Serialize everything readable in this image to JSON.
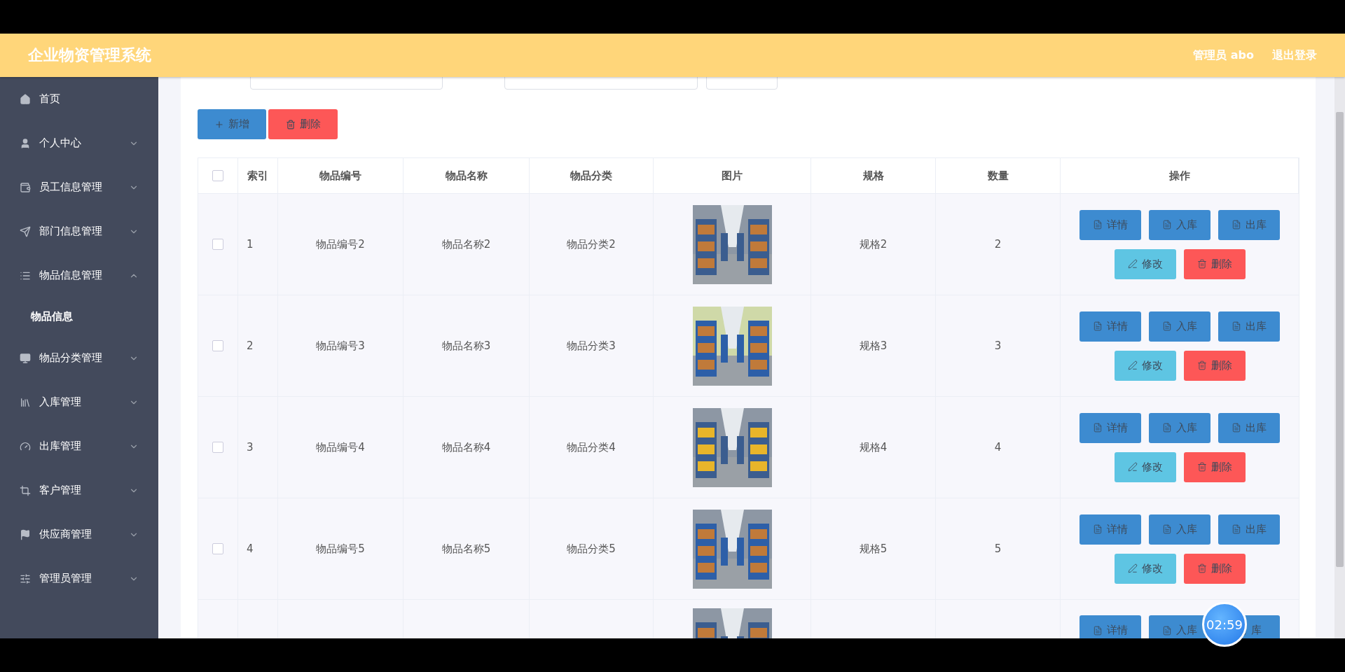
{
  "header": {
    "title": "企业物资管理系统",
    "user": "管理员 abo",
    "logout": "退出登录"
  },
  "sidebar": {
    "items": [
      {
        "label": "首页",
        "kind": "link"
      },
      {
        "label": "个人中心",
        "kind": "menu",
        "expanded": false
      },
      {
        "label": "员工信息管理",
        "kind": "menu",
        "expanded": false
      },
      {
        "label": "部门信息管理",
        "kind": "menu",
        "expanded": false
      },
      {
        "label": "物品信息管理",
        "kind": "menu",
        "expanded": true,
        "children": [
          {
            "label": "物品信息",
            "selected": true
          }
        ]
      },
      {
        "label": "物品分类管理",
        "kind": "menu",
        "expanded": false
      },
      {
        "label": "入库管理",
        "kind": "menu",
        "expanded": false
      },
      {
        "label": "出库管理",
        "kind": "menu",
        "expanded": false
      },
      {
        "label": "客户管理",
        "kind": "menu",
        "expanded": false
      },
      {
        "label": "供应商管理",
        "kind": "menu",
        "expanded": false
      },
      {
        "label": "管理员管理",
        "kind": "menu",
        "expanded": false
      }
    ]
  },
  "toolbar": [
    {
      "label": "新增",
      "kind": "primary"
    },
    {
      "label": "删除",
      "kind": "danger"
    }
  ],
  "table": {
    "select_all_checked": false,
    "columns": [
      "索引",
      "物品编号",
      "物品名称",
      "物品分类",
      "图片",
      "规格",
      "数量",
      "操作"
    ],
    "rows": [
      {
        "kind": "full",
        "checked": false,
        "cells": [
          "1",
          "物品编号2",
          "物品名称2",
          "物品分类2",
          "规格2",
          "2"
        ],
        "actions": [
          {
            "label": "详情",
            "kind": "primary"
          },
          {
            "label": "入库",
            "kind": "primary"
          },
          {
            "label": "出库",
            "kind": "primary"
          },
          {
            "label": "修改",
            "kind": "info"
          },
          {
            "label": "删除",
            "kind": "danger"
          }
        ]
      },
      {
        "kind": "full",
        "checked": false,
        "cells": [
          "2",
          "物品编号3",
          "物品名称3",
          "物品分类3",
          "规格3",
          "3"
        ],
        "actions": [
          {
            "label": "详情",
            "kind": "primary"
          },
          {
            "label": "入库",
            "kind": "primary"
          },
          {
            "label": "出库",
            "kind": "primary"
          },
          {
            "label": "修改",
            "kind": "info"
          },
          {
            "label": "删除",
            "kind": "danger"
          }
        ]
      },
      {
        "kind": "full",
        "checked": false,
        "cells": [
          "3",
          "物品编号4",
          "物品名称4",
          "物品分类4",
          "规格4",
          "4"
        ],
        "actions": [
          {
            "label": "详情",
            "kind": "primary"
          },
          {
            "label": "入库",
            "kind": "primary"
          },
          {
            "label": "出库",
            "kind": "primary"
          },
          {
            "label": "修改",
            "kind": "info"
          },
          {
            "label": "删除",
            "kind": "danger"
          }
        ]
      },
      {
        "kind": "full",
        "checked": false,
        "cells": [
          "4",
          "物品编号5",
          "物品名称5",
          "物品分类5",
          "规格5",
          "5"
        ],
        "actions": [
          {
            "label": "详情",
            "kind": "primary"
          },
          {
            "label": "入库",
            "kind": "primary"
          },
          {
            "label": "出库",
            "kind": "primary"
          },
          {
            "label": "修改",
            "kind": "info"
          },
          {
            "label": "删除",
            "kind": "danger"
          }
        ]
      },
      {
        "kind": "partial",
        "actions": [
          {
            "label": "详情",
            "kind": "primary"
          },
          {
            "label": "入库",
            "kind": "primary"
          },
          {
            "label": "库",
            "kind": "primary"
          }
        ]
      }
    ]
  },
  "recording_timer": "02:59"
}
